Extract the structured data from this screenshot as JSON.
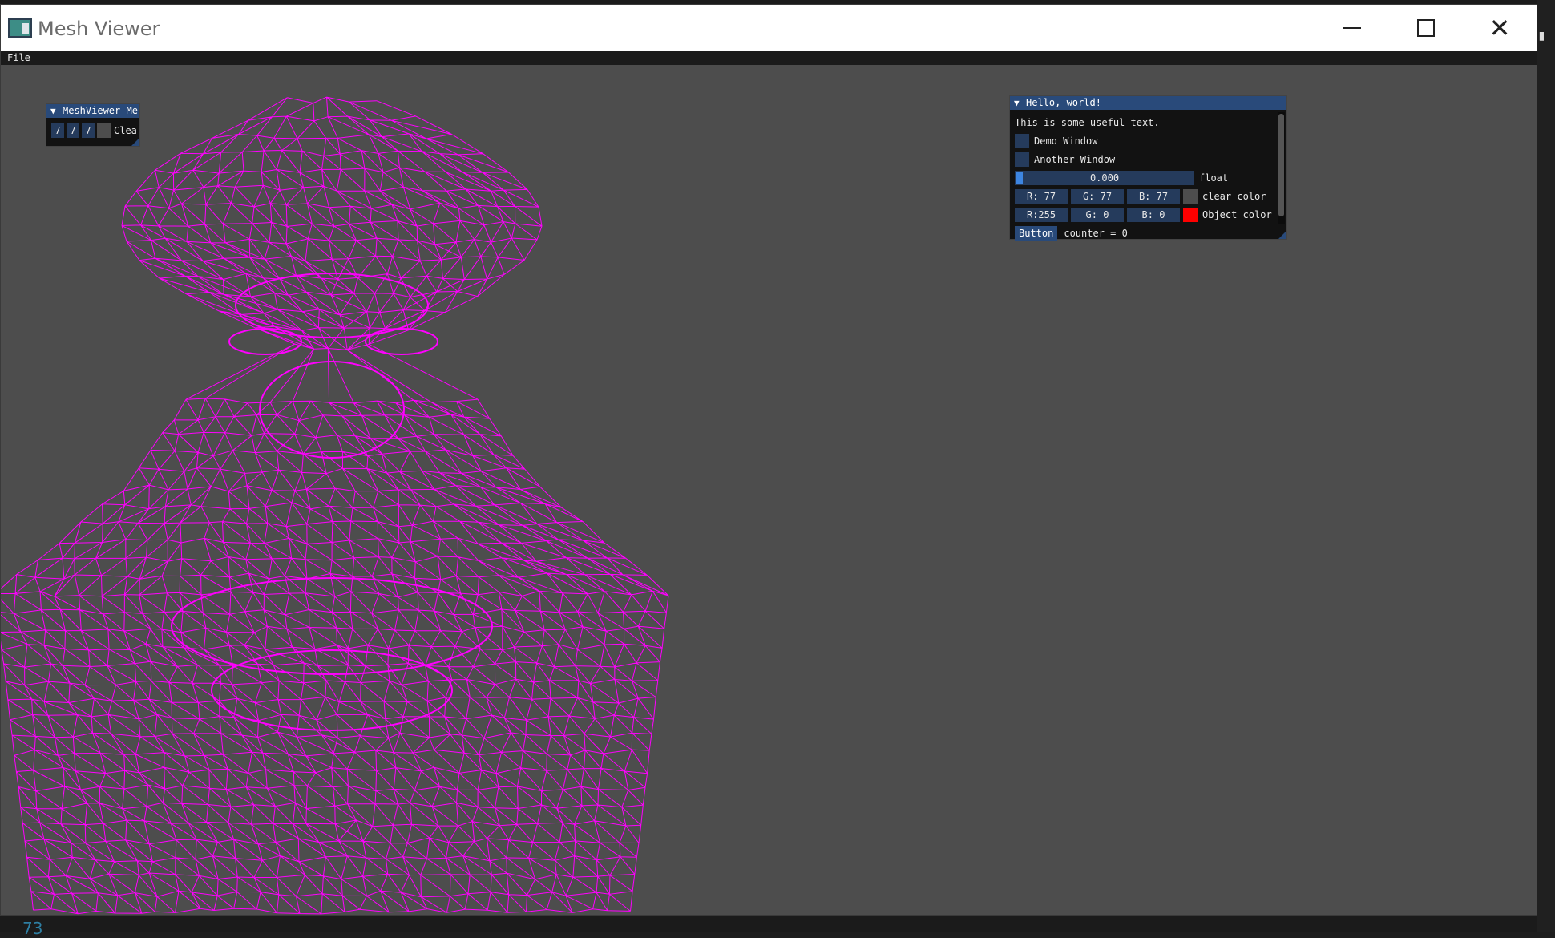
{
  "window": {
    "title": "Mesh Viewer"
  },
  "menu": {
    "file_label": "File"
  },
  "mesh": {
    "color": "#ff00ff",
    "background": "#4d4d4d"
  },
  "meshviewer_panel": {
    "title": "MeshViewer Men",
    "values": [
      "7",
      "7",
      "7"
    ],
    "label": "Clea"
  },
  "hello_panel": {
    "title": "Hello, world!",
    "text": "This is some useful text.",
    "checkbox_demo_label": "Demo Window",
    "checkbox_another_label": "Another Window",
    "slider_value": "0.000",
    "slider_label": "float",
    "clear_color": {
      "r": "R: 77",
      "g": "G: 77",
      "b": "B: 77",
      "label": "clear color",
      "swatch": "#4d4d4d"
    },
    "object_color": {
      "r": "R:255",
      "g": "G:  0",
      "b": "B:  0",
      "label": "Object color",
      "swatch": "#ff0000"
    },
    "button_label": "Button",
    "counter_text": "counter = 0"
  },
  "taskbar": {
    "fragment": "73"
  }
}
